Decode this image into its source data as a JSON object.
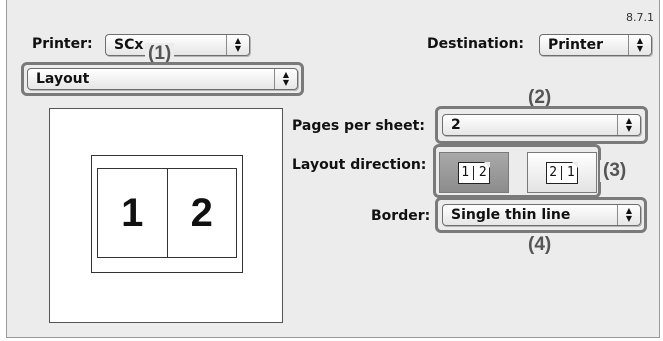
{
  "version": "8.7.1",
  "printer": {
    "label": "Printer:",
    "value": "SCx"
  },
  "destination": {
    "label": "Destination:",
    "value": "Printer"
  },
  "panel_select": {
    "value": "Layout"
  },
  "pages_per_sheet": {
    "label": "Pages per sheet:",
    "value": "2"
  },
  "layout_direction": {
    "label": "Layout direction:",
    "options": [
      {
        "left": "1",
        "right": "2",
        "selected": true
      },
      {
        "left": "2",
        "right": "1",
        "selected": false
      }
    ]
  },
  "border": {
    "label": "Border:",
    "value": "Single thin line"
  },
  "preview": {
    "page_left": "1",
    "page_right": "2"
  },
  "callouts": [
    "(1)",
    "(2)",
    "(3)",
    "(4)"
  ],
  "icons": {
    "popup_arrows": "up-down-arrows-icon",
    "direction_left_to_right": "layout-lr-icon",
    "direction_right_to_left": "layout-rl-icon"
  },
  "colors": {
    "background": "#ececec",
    "highlight": "#7a7a7a",
    "selected_button": "#9a9a9a"
  }
}
